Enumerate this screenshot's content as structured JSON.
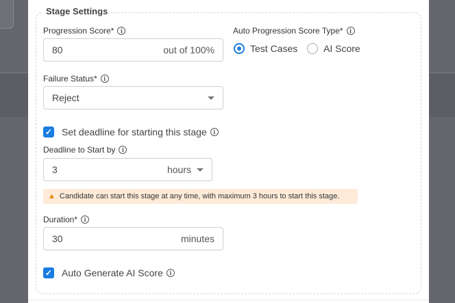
{
  "section_title": "Stage Settings",
  "progression": {
    "label": "Progression Score*",
    "value": "80",
    "suffix": "out of 100%"
  },
  "auto_progression": {
    "label": "Auto Progression Score Type*",
    "options": [
      {
        "label": "Test Cases",
        "selected": true
      },
      {
        "label": "AI Score",
        "selected": false
      }
    ]
  },
  "failure_status": {
    "label": "Failure Status*",
    "value": "Reject"
  },
  "deadline_toggle": {
    "label": "Set deadline for starting this stage",
    "checked": true
  },
  "deadline": {
    "label": "Deadline to Start by",
    "value": "3",
    "unit": "hours"
  },
  "warning": {
    "text": "Candidate can start this stage at any time, with maximum 3 hours to start this stage."
  },
  "duration": {
    "label": "Duration*",
    "value": "30",
    "unit": "minutes"
  },
  "ai_score_toggle": {
    "label": "Auto Generate AI Score",
    "checked": true
  },
  "colors": {
    "accent": "#1a7de0",
    "warning_bg": "#fdebd8",
    "warning_icon": "#e08a00"
  }
}
